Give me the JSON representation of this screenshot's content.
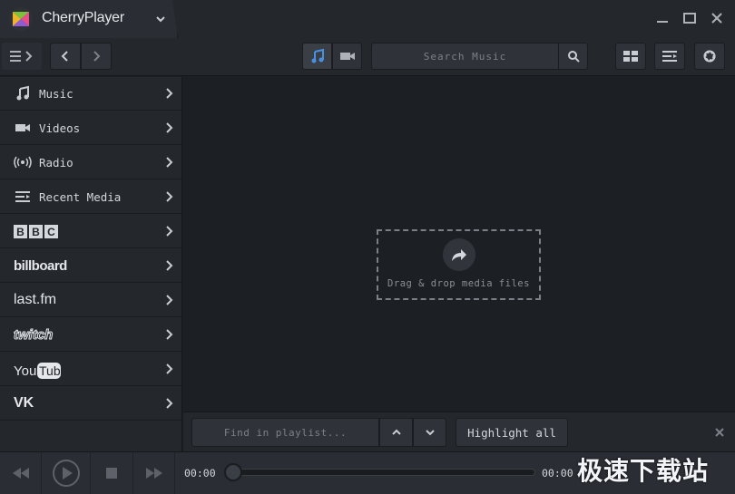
{
  "app": {
    "title": "CherryPlayer"
  },
  "toolbar": {
    "search_placeholder": "Search Music"
  },
  "sidebar": {
    "items": [
      {
        "label": "Music",
        "icon": "music-note-icon"
      },
      {
        "label": "Videos",
        "icon": "video-camera-icon"
      },
      {
        "label": "Radio",
        "icon": "radio-icon"
      },
      {
        "label": "Recent Media",
        "icon": "recent-media-icon"
      },
      {
        "label": "BBC",
        "icon": "bbc-logo"
      },
      {
        "label": "billboard",
        "icon": "billboard-logo"
      },
      {
        "label": "last.fm",
        "icon": "lastfm-logo"
      },
      {
        "label": "twitch",
        "icon": "twitch-logo"
      },
      {
        "label": "YouTube",
        "icon": "youtube-logo"
      },
      {
        "label": "VK",
        "icon": "vk-logo"
      }
    ]
  },
  "main": {
    "drop_text": "Drag & drop media files"
  },
  "findbar": {
    "placeholder": "Find in playlist...",
    "highlight_label": "Highlight all"
  },
  "player": {
    "time_elapsed": "00:00",
    "time_total": "00:00",
    "progress": 0
  },
  "watermark": "极速下载站",
  "colors": {
    "accent": "#4a90e2",
    "background": "#1c1f24",
    "panel": "#24272c"
  }
}
